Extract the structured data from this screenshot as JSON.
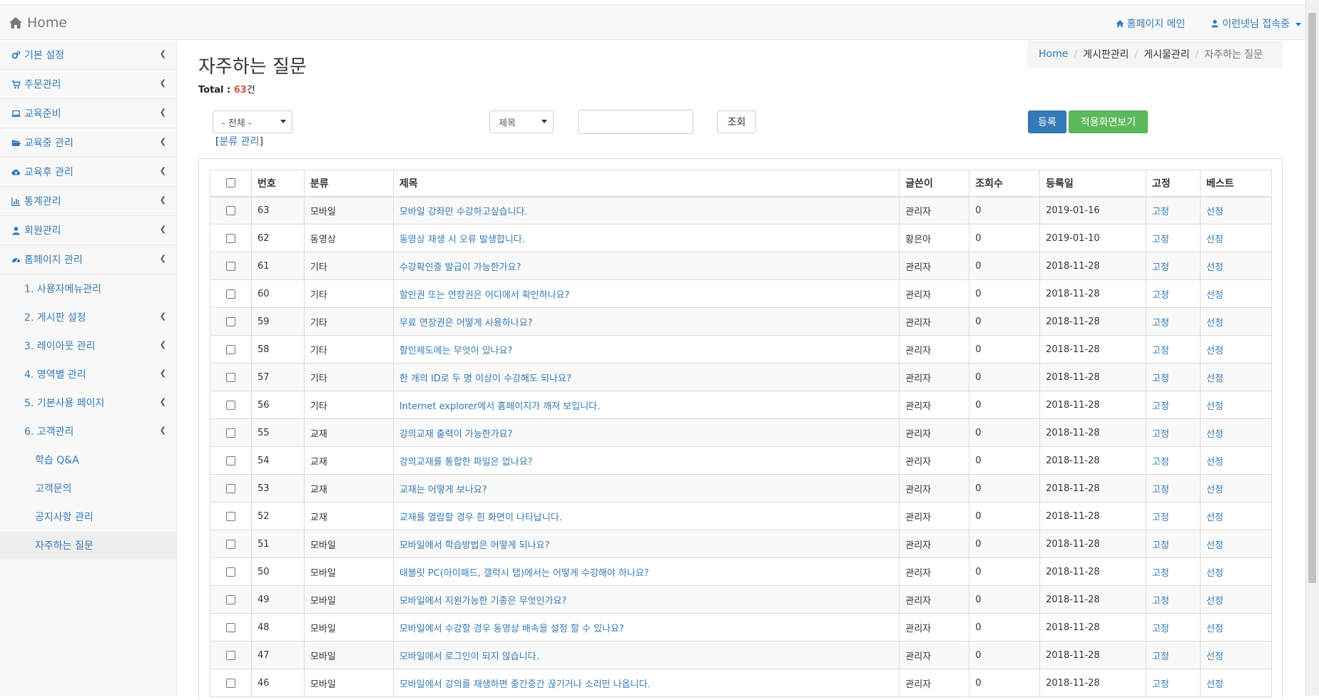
{
  "header": {
    "brand": "Home",
    "homepage_main": "홈페이지 메인",
    "user_status": "이런넷님 접속중"
  },
  "sidebar": {
    "items": [
      {
        "label": "기본 설정",
        "icon": "gears-icon"
      },
      {
        "label": "주문관리",
        "icon": "cart-icon"
      },
      {
        "label": "교육준비",
        "icon": "laptop-icon"
      },
      {
        "label": "교육중 관리",
        "icon": "folder-open-icon"
      },
      {
        "label": "교육후 관리",
        "icon": "cloud-upload-icon"
      },
      {
        "label": "통계관리",
        "icon": "bar-chart-icon"
      },
      {
        "label": "회원관리",
        "icon": "user-icon"
      },
      {
        "label": "홈페이지 관리",
        "icon": "dashboard-icon"
      }
    ],
    "sub_items": [
      {
        "label": "1. 사용자메뉴관리",
        "chevron": false
      },
      {
        "label": "2. 게시판 설정",
        "chevron": true
      },
      {
        "label": "3. 레이아웃 관리",
        "chevron": true
      },
      {
        "label": "4. 영역별 관리",
        "chevron": true
      },
      {
        "label": "5. 기본사용 페이지",
        "chevron": true
      },
      {
        "label": "6. 고객관리",
        "chevron": true
      }
    ],
    "subsub_items": [
      {
        "label": "학습 Q&A"
      },
      {
        "label": "고객문의"
      },
      {
        "label": "공지사항 관리"
      },
      {
        "label": "자주하는 질문"
      }
    ]
  },
  "breadcrumb": [
    "Home",
    "게시판관리",
    "게시물관리",
    "자주하는 질문"
  ],
  "page": {
    "title": "자주하는 질문",
    "total_label": "Total : ",
    "total_count": "63",
    "total_unit": "건"
  },
  "filters": {
    "category_select": "- 전체 -",
    "field_select": "제목",
    "search_value": "",
    "search_button": "조회",
    "register_button": "등록",
    "preview_button": "적용화면보기",
    "category_manage": "분류 관리"
  },
  "table": {
    "headers": [
      "번호",
      "분류",
      "제목",
      "글쓴이",
      "조회수",
      "등록일",
      "고정",
      "베스트"
    ],
    "rows": [
      {
        "no": "63",
        "cat": "모바일",
        "title": "모바일 강좌만 수강하고싶습니다.",
        "author": "관리자",
        "views": "0",
        "date": "2019-01-16",
        "pin": "고정",
        "best": "선정"
      },
      {
        "no": "62",
        "cat": "동영상",
        "title": "동영상 재생 시 오류 발생합니다.",
        "author": "황은아",
        "views": "0",
        "date": "2019-01-10",
        "pin": "고정",
        "best": "선정"
      },
      {
        "no": "61",
        "cat": "기타",
        "title": "수강확인증 발급이 가능한가요?",
        "author": "관리자",
        "views": "0",
        "date": "2018-11-28",
        "pin": "고정",
        "best": "선정"
      },
      {
        "no": "60",
        "cat": "기타",
        "title": "할인권 또는 연장권은 어디에서 확인하나요?",
        "author": "관리자",
        "views": "0",
        "date": "2018-11-28",
        "pin": "고정",
        "best": "선정"
      },
      {
        "no": "59",
        "cat": "기타",
        "title": "무료 연장권은 어떻게 사용하나요?",
        "author": "관리자",
        "views": "0",
        "date": "2018-11-28",
        "pin": "고정",
        "best": "선정"
      },
      {
        "no": "58",
        "cat": "기타",
        "title": "할인제도에는 무엇이 있나요?",
        "author": "관리자",
        "views": "0",
        "date": "2018-11-28",
        "pin": "고정",
        "best": "선정"
      },
      {
        "no": "57",
        "cat": "기타",
        "title": "한 개의 ID로 두 명 이상이 수강해도 되나요?",
        "author": "관리자",
        "views": "0",
        "date": "2018-11-28",
        "pin": "고정",
        "best": "선정"
      },
      {
        "no": "56",
        "cat": "기타",
        "title": "Internet explorer에서 홈페이지가 깨져 보입니다.",
        "author": "관리자",
        "views": "0",
        "date": "2018-11-28",
        "pin": "고정",
        "best": "선정"
      },
      {
        "no": "55",
        "cat": "교재",
        "title": "강의교재 출력이 가능한가요?",
        "author": "관리자",
        "views": "0",
        "date": "2018-11-28",
        "pin": "고정",
        "best": "선정"
      },
      {
        "no": "54",
        "cat": "교재",
        "title": "강의교재를 통합한 파일은 없나요?",
        "author": "관리자",
        "views": "0",
        "date": "2018-11-28",
        "pin": "고정",
        "best": "선정"
      },
      {
        "no": "53",
        "cat": "교재",
        "title": "교재는 어떻게 보나요?",
        "author": "관리자",
        "views": "0",
        "date": "2018-11-28",
        "pin": "고정",
        "best": "선정"
      },
      {
        "no": "52",
        "cat": "교재",
        "title": "교재를 열람할 경우 흰 화면이 나타납니다.",
        "author": "관리자",
        "views": "0",
        "date": "2018-11-28",
        "pin": "고정",
        "best": "선정"
      },
      {
        "no": "51",
        "cat": "모바일",
        "title": "모바일에서 학습방법은 어떻게 되나요?",
        "author": "관리자",
        "views": "0",
        "date": "2018-11-28",
        "pin": "고정",
        "best": "선정"
      },
      {
        "no": "50",
        "cat": "모바일",
        "title": "태블릿 PC(아이패드, 갤럭시 탭)에서는 어떻게 수강해야 하나요?",
        "author": "관리자",
        "views": "0",
        "date": "2018-11-28",
        "pin": "고정",
        "best": "선정"
      },
      {
        "no": "49",
        "cat": "모바일",
        "title": "모바일에서 지원가능한 기종은 무엇인가요?",
        "author": "관리자",
        "views": "0",
        "date": "2018-11-28",
        "pin": "고정",
        "best": "선정"
      },
      {
        "no": "48",
        "cat": "모바일",
        "title": "모바일에서 수강할 경우 동영상 배속을 설정 할 수 있나요?",
        "author": "관리자",
        "views": "0",
        "date": "2018-11-28",
        "pin": "고정",
        "best": "선정"
      },
      {
        "no": "47",
        "cat": "모바일",
        "title": "모바일에서 로그인이 되지 않습니다.",
        "author": "관리자",
        "views": "0",
        "date": "2018-11-28",
        "pin": "고정",
        "best": "선정"
      },
      {
        "no": "46",
        "cat": "모바일",
        "title": "모바일에서 강의를 재생하면 중간중간 끊기거나 소리만 나옵니다.",
        "author": "관리자",
        "views": "0",
        "date": "2018-11-28",
        "pin": "고정",
        "best": "선정"
      }
    ]
  }
}
